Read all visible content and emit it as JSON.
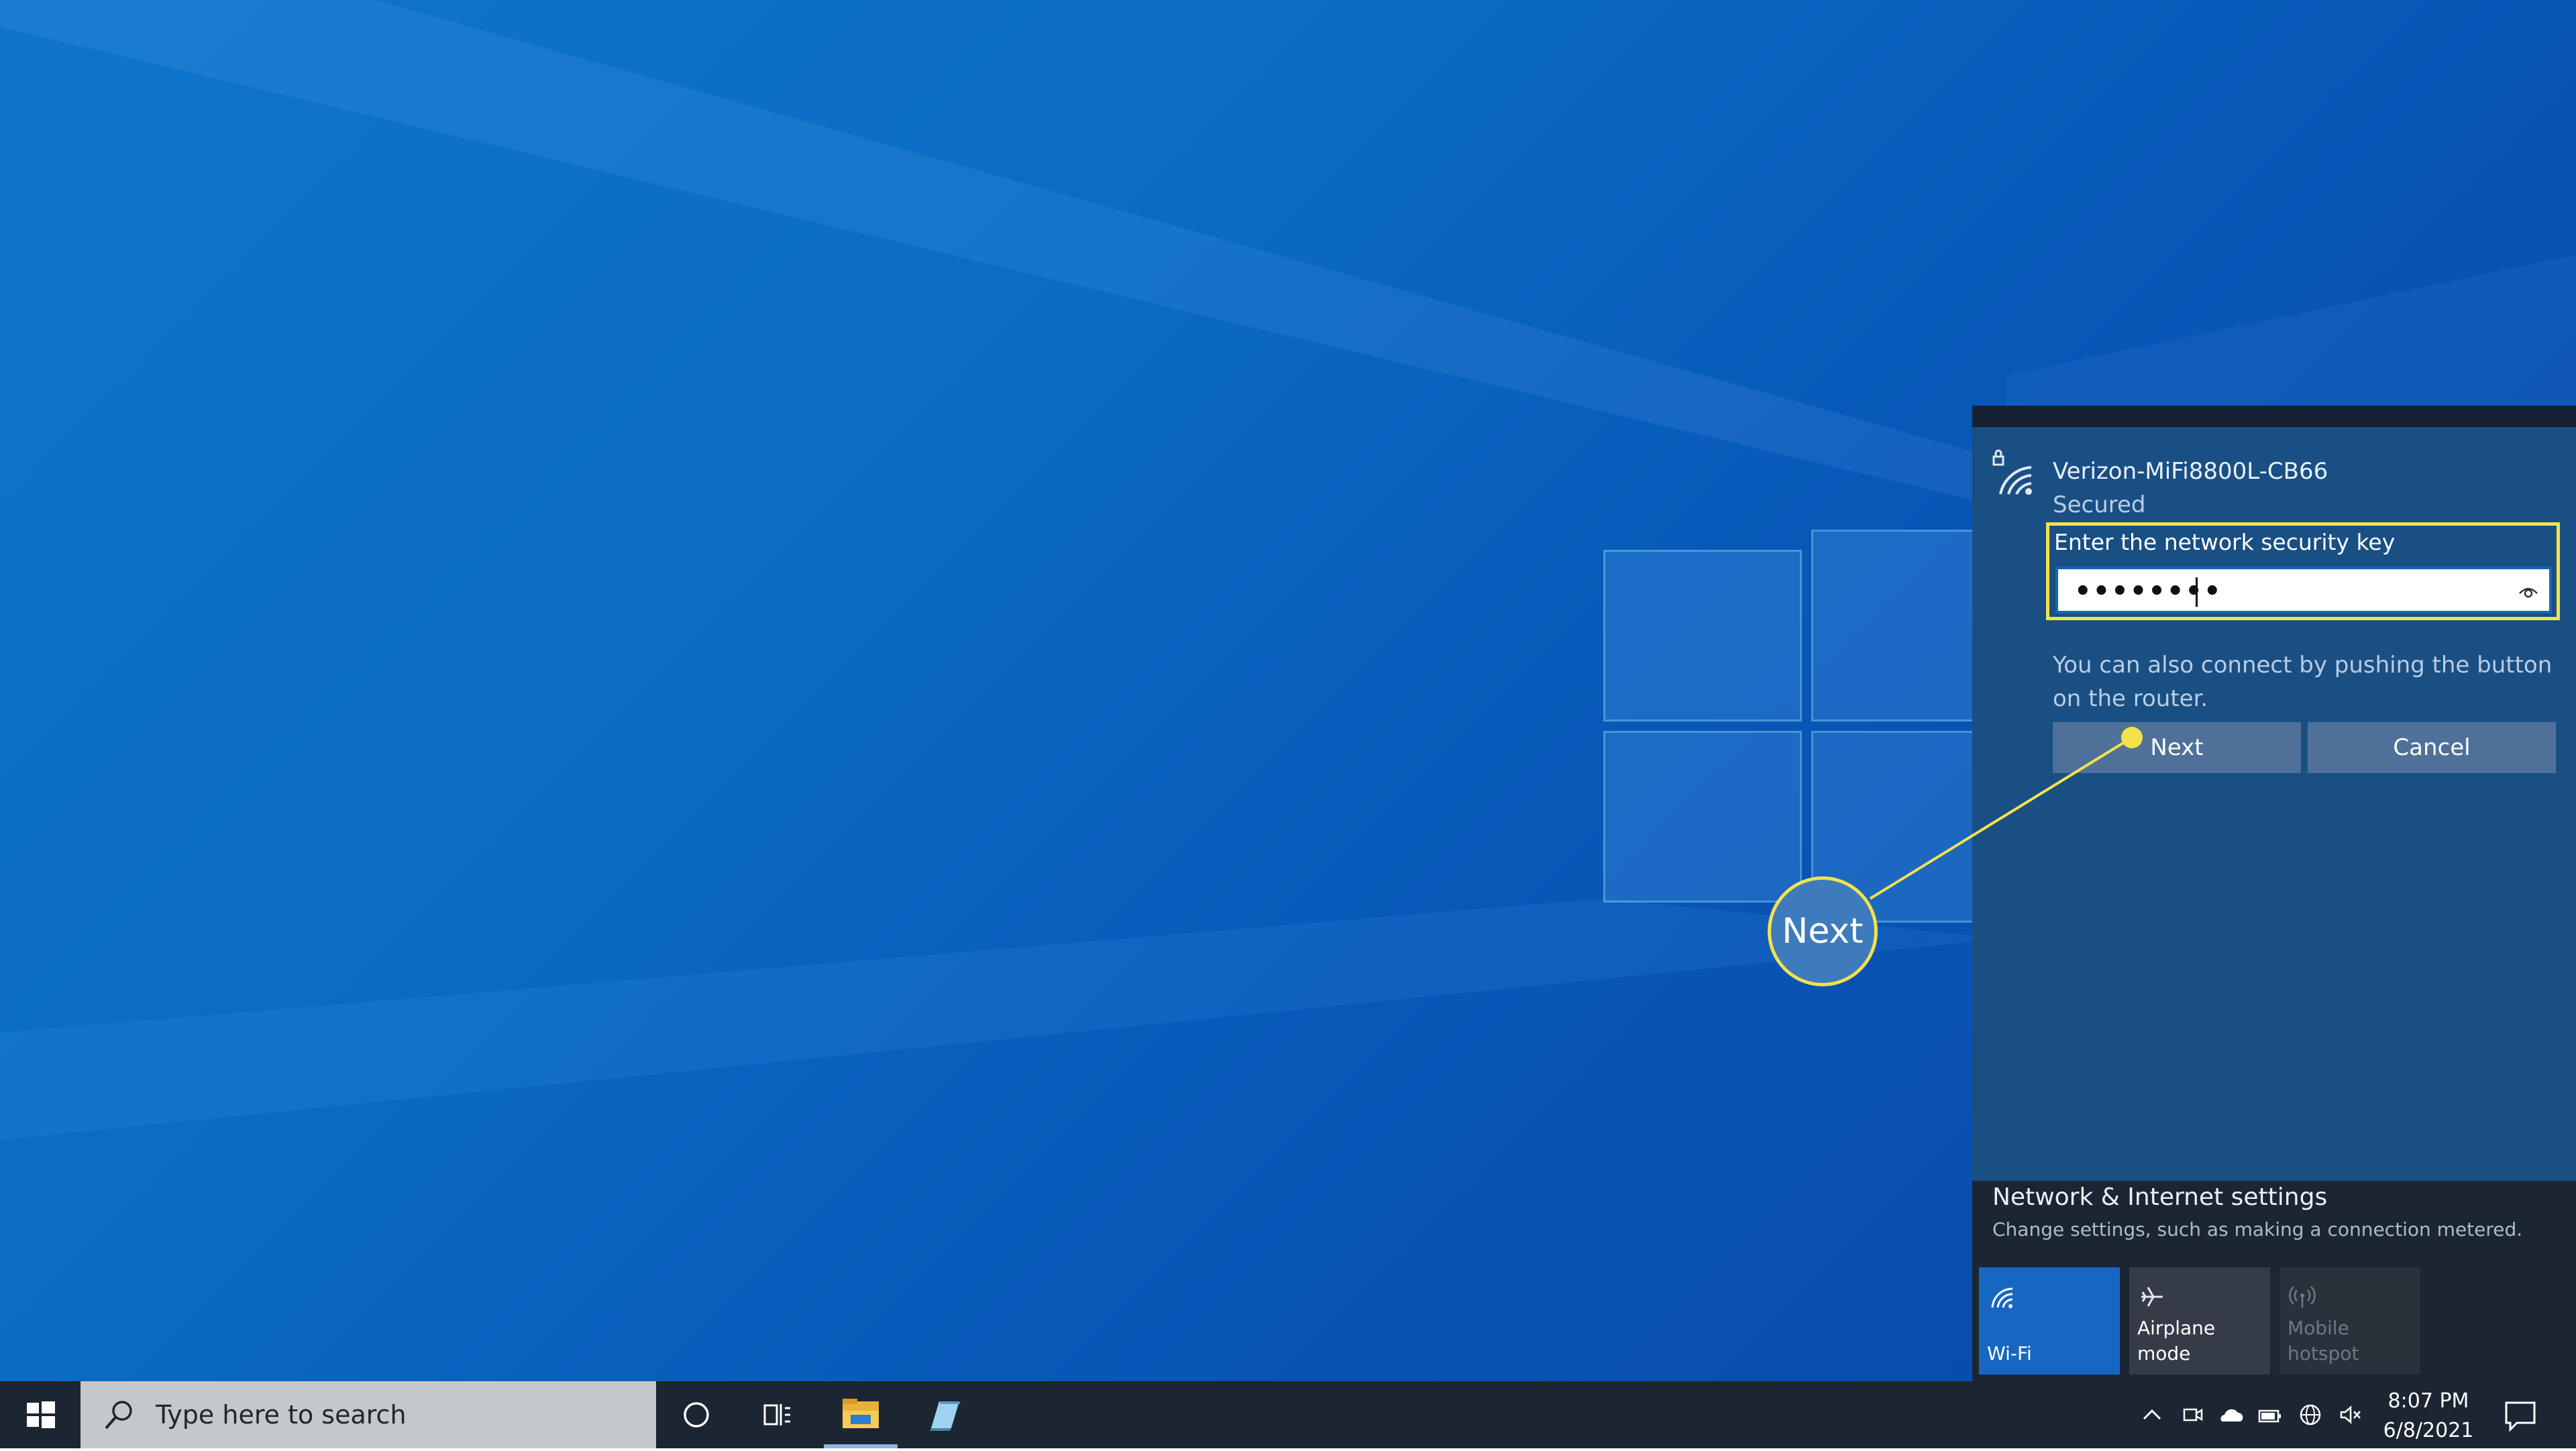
{
  "colors": {
    "accent": "#1767c2",
    "highlight": "#f4e24c",
    "flyout_bg": "#1c2532",
    "network_card_bg": "#1a4f84",
    "button_bg": "#4f7199",
    "taskbar_bg": "#1c2532"
  },
  "flyout": {
    "network": {
      "icon": "wifi-lock-icon",
      "name": "Verizon-MiFi8800L-CB66",
      "status": "Secured",
      "key_label": "Enter the network security key",
      "key_value": "••••••••",
      "reveal_icon": "eye-icon",
      "wps_hint": "You can also connect by pushing the button on the router.",
      "next_label": "Next",
      "cancel_label": "Cancel"
    },
    "settings": {
      "title": "Network & Internet settings",
      "subtitle": "Change settings, such as making a connection metered."
    },
    "quick_actions": [
      {
        "label": "Wi-Fi",
        "icon": "wifi-icon",
        "state": "on"
      },
      {
        "label": "Airplane mode",
        "icon": "airplane-icon",
        "state": "off"
      },
      {
        "label": "Mobile hotspot",
        "icon": "hotspot-icon",
        "state": "disabled"
      }
    ]
  },
  "callout": {
    "label": "Next"
  },
  "taskbar": {
    "start_icon": "windows-logo-icon",
    "search_placeholder": "Type here to search",
    "pinned": [
      "cortana-icon",
      "task-view-icon",
      "file-explorer-icon",
      "app-icon"
    ],
    "tray_icons": [
      "chevron-up-icon",
      "meet-now-icon",
      "onedrive-icon",
      "battery-icon",
      "globe-network-icon",
      "volume-muted-icon"
    ],
    "time": "8:07 PM",
    "date": "6/8/2021",
    "notification_icon": "action-center-icon"
  }
}
